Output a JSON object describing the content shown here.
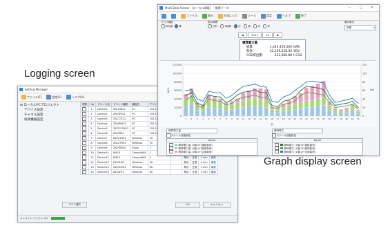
{
  "captions": {
    "logging": "Logging screen",
    "graph": "Graph display screen"
  },
  "settings_window": {
    "title": "Setting Manager",
    "toolbar": [
      {
        "label": "ファイル(F)",
        "icon": "folder-icon",
        "color": "#e8b64a"
      },
      {
        "label": "設定(S)",
        "icon": "settings-icon",
        "color": "#6b86b3"
      },
      {
        "label": "ヘルプ(H)",
        "icon": "help-icon",
        "color": "#4b8fd8"
      }
    ],
    "tree": {
      "root": "ローカルPCプロジェクト",
      "items": [
        "デバイス設定",
        "チャネル設定",
        "収録機器設定"
      ]
    },
    "table": {
      "headers": [
        "選択",
        "No",
        "デバイス名",
        "デバイス種別",
        "通信先",
        "デバイスアドレス",
        "ポート",
        "状態",
        "",
        "周期",
        ""
      ],
      "rows": [
        [
          "1",
          "Device1",
          "ZN-THX21",
          "PC",
          "192.168.0.10",
          "有効"
        ],
        [
          "2",
          "Device2",
          "ZN-SPX21",
          "PC",
          "192.168.0.11",
          "有効"
        ],
        [
          "3",
          "Device3",
          "ZN-CTX21",
          "PC",
          "192.168.0.12",
          "有効"
        ],
        [
          "4",
          "Device4",
          "ZN-KMX21",
          "PC",
          "192.168.0.13",
          "有効"
        ],
        [
          "5",
          "Device5",
          "Z4FZ-FG401",
          "PC",
          "192.168.0.14",
          "有効"
        ],
        [
          "6",
          "Device6",
          "ZN-PDA1",
          "PC",
          "192.168.0.15",
          "有効"
        ],
        [
          "7",
          "Device7",
          "NZ-DTH51",
          "Wireless",
          "20",
          "有効"
        ],
        [
          "8",
          "Device8",
          "ZN-DTH51",
          "Wireless",
          "30",
          "有効"
        ],
        [
          "9",
          "Device9",
          "ZN-PDB10",
          "Slave",
          "1",
          "有効"
        ],
        [
          "10",
          "Device10",
          "KM20",
          "CompoWAY",
          "1",
          "有効",
          "正常",
          "1 min",
          "編集"
        ],
        [
          "11",
          "Device11",
          "KM20",
          "CompoWAY",
          "2",
          "有効",
          "正常",
          "1 min",
          "編集"
        ],
        [
          "12",
          "Device12",
          "NZ-DU01",
          "Wireless",
          "50",
          "有効",
          "正常",
          "1 min",
          "編集"
        ],
        [
          "13",
          "Device13",
          "NZ-DC001",
          "Wireless",
          "60",
          "有効",
          "正常",
          "1 min",
          "編集"
        ],
        [
          "14",
          "Device14",
          "NZ-DF01",
          "Wireless",
          "60",
          "有効",
          "正常",
          "1 min",
          "編集"
        ]
      ]
    },
    "buttons": {
      "left": "すべて選択",
      "ok": "OK",
      "cancel": "キャンセル"
    },
    "status": {
      "text": "オンライン  バッファ 3%",
      "progress_pct": 30
    }
  },
  "graph_window": {
    "title": "Multi Data Viewer ［ローカル環境］ - 帳票データ",
    "controls": "－  □  ×",
    "toolbar": [
      {
        "label": "",
        "icon": "back-icon",
        "color": "#4b8fd8"
      },
      {
        "label": "",
        "icon": "forward-icon",
        "color": "#4b8fd8"
      },
      {
        "label": "ファイル",
        "icon": "file-icon",
        "color": "#e8b64a"
      },
      {
        "label": "表示",
        "icon": "view-icon",
        "color": "#5aa65a"
      },
      {
        "label": "お気に入り",
        "icon": "favorite-icon",
        "color": "#e8b64a"
      },
      {
        "label": "ツール",
        "icon": "tool-icon",
        "color": "#888888"
      },
      {
        "label": "設定",
        "icon": "settings-icon",
        "color": "#6b86b3"
      },
      {
        "label": "ヘルプ",
        "icon": "help-icon",
        "color": "#4b8fd8"
      },
      {
        "label": "終了",
        "icon": "exit-icon",
        "color": "#5aa65a"
      }
    ],
    "options": {
      "group1_label": "グラフ種別",
      "group1": [
        "折れ線",
        "棒"
      ],
      "group2_label": "表示期間",
      "group2": [
        "日別",
        "1時間",
        "日",
        "週",
        "月",
        "年"
      ],
      "scale_label": "集計単位",
      "scale_value": "時間"
    },
    "nav": {
      "prev": "◀",
      "year": "2011",
      "month": "10",
      "next": "▶"
    },
    "summary": {
      "title": "積算電力量",
      "rows": [
        {
          "label": "総量:",
          "value": "1,443,450.000",
          "unit": "kWh"
        },
        {
          "label": "料金:",
          "value": "22,169,258.00",
          "unit": "YEN"
        },
        {
          "label": "CO2排出量:",
          "value": "452,686.88",
          "unit": "t-CO2"
        }
      ]
    },
    "panels": [
      {
        "select": "積算電力量",
        "scale": "スケール自動設定",
        "header": "Name",
        "items": [
          {
            "label": "積算電力量 (1階(0F)運転負荷)",
            "color": "#9ec6ea"
          },
          {
            "label": "積算電力量 (1階(1F)照明負荷)",
            "color": "#a9d67f"
          },
          {
            "label": "積算電力量 (1階(1F)空調負荷)",
            "color": "#e9a0c2"
          }
        ]
      },
      {
        "select": "瞬時電力",
        "scale": "スケール自動設定",
        "header": "Name",
        "items": [
          {
            "label": "瞬時電力 (1階(0F)運転負荷)",
            "color": "#2d6f2d"
          },
          {
            "label": "瞬時電力 (1階(1F)照明負荷)",
            "color": "#4da64d"
          },
          {
            "label": "瞬時電力 (1階(1F)空調負荷)",
            "color": "#1e7fc4"
          }
        ]
      }
    ]
  },
  "chart_data": {
    "type": "bar",
    "title": "",
    "xlabel": "日",
    "ylabel": "kWh",
    "y2label": "kW",
    "categories": [
      "1",
      "2",
      "3",
      "4",
      "5",
      "6",
      "7",
      "8",
      "9",
      "10",
      "11",
      "12",
      "13",
      "14",
      "15",
      "16",
      "17",
      "18",
      "19",
      "20",
      "21",
      "22",
      "23",
      "24",
      "25",
      "26",
      "27",
      "28",
      "29",
      "30",
      "31"
    ],
    "ylim": [
      0,
      120000
    ],
    "y2lim": [
      0,
      120
    ],
    "yticks": [
      "0",
      "20000",
      "40000",
      "60000",
      "80000",
      "100000",
      "120000"
    ],
    "y2ticks": [
      "0",
      "20",
      "40",
      "60",
      "80",
      "100",
      "120"
    ],
    "series": [
      {
        "values": [
          22000,
          28000,
          14000,
          12000,
          21000,
          19000,
          18000,
          14000,
          15000,
          17000,
          20000,
          22000,
          24000,
          22000,
          20000,
          9000,
          9000,
          12000,
          14000,
          16000,
          18000,
          20000,
          21000,
          23000,
          25000,
          14000,
          8000,
          7000,
          8000,
          12000,
          6000
        ]
      },
      {
        "values": [
          18000,
          22000,
          11000,
          9000,
          17000,
          15000,
          14000,
          11000,
          12000,
          14000,
          16000,
          18000,
          19000,
          17000,
          16000,
          7000,
          7000,
          9000,
          11000,
          13000,
          14000,
          16000,
          17000,
          18000,
          20000,
          11000,
          6000,
          5000,
          6000,
          9000,
          5000
        ]
      },
      {
        "values": [
          12000,
          15000,
          7000,
          6000,
          11000,
          10000,
          9000,
          7000,
          8000,
          10000,
          18000,
          20000,
          22000,
          26000,
          27000,
          5000,
          5000,
          8000,
          12000,
          18000,
          22000,
          30000,
          33000,
          35000,
          38000,
          9000,
          4000,
          4000,
          5000,
          6000,
          3000
        ]
      },
      {
        "values": [
          48,
          55,
          30,
          25,
          50,
          46,
          45,
          32,
          38,
          50,
          56,
          58,
          62,
          55,
          56,
          25,
          22,
          35,
          38,
          45,
          60,
          70,
          68,
          66,
          62,
          40,
          25,
          28,
          30,
          35,
          20
        ]
      },
      {
        "values": [
          38,
          46,
          24,
          20,
          40,
          36,
          35,
          26,
          30,
          40,
          44,
          46,
          50,
          44,
          45,
          20,
          18,
          28,
          30,
          36,
          48,
          56,
          54,
          52,
          50,
          32,
          20,
          22,
          24,
          28,
          16
        ]
      },
      {
        "values": [
          60,
          62,
          40,
          35,
          58,
          55,
          55,
          42,
          48,
          60,
          70,
          72,
          75,
          70,
          68,
          35,
          32,
          45,
          50,
          60,
          70,
          80,
          82,
          80,
          78,
          50,
          32,
          35,
          38,
          42,
          30
        ]
      }
    ]
  }
}
